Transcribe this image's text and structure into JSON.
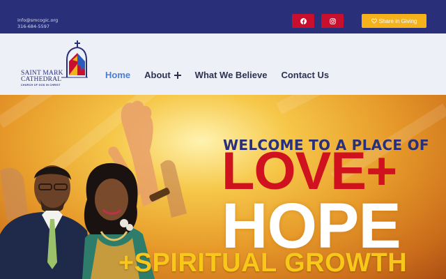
{
  "topbar": {
    "email": "info@smcogic.org",
    "phone": "316-684-5597",
    "social": [
      {
        "name": "facebook-icon"
      },
      {
        "name": "instagram-icon"
      }
    ],
    "give_label": "Share in Giving",
    "colors": {
      "bar": "#2a2f7a",
      "social": "#c8102e",
      "give": "#f5b21b"
    }
  },
  "logo": {
    "line1": "SAINT MARK",
    "line2": "CATHEDRAL",
    "line3": "CHURCH OF GOD IN CHRIST"
  },
  "nav": {
    "items": [
      {
        "label": "Home",
        "active": true
      },
      {
        "label": "About",
        "has_submenu": true
      },
      {
        "label": "What We Believe"
      },
      {
        "label": "Contact Us"
      }
    ],
    "colors": {
      "active": "#4a7fd4",
      "default": "#2d3250"
    }
  },
  "hero": {
    "welcome": "WELCOME TO A PLACE OF",
    "love": "LOVE+",
    "hope": "HOPE",
    "spiritual": "+SPIRITUAL GROWTH"
  }
}
